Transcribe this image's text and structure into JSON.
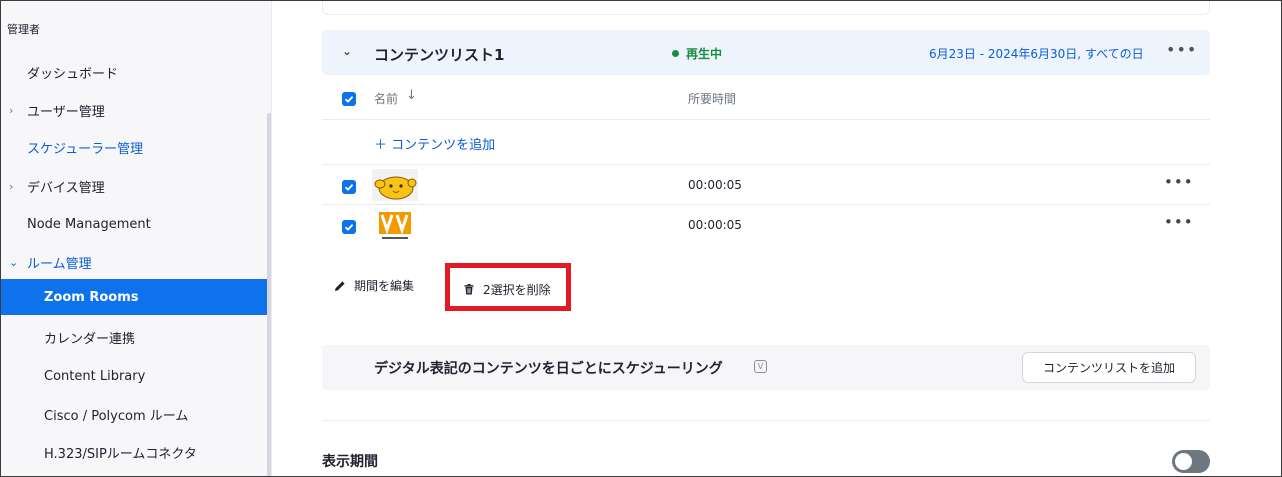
{
  "sidebar": {
    "header": "管理者",
    "items": [
      {
        "label": "ダッシュボード",
        "chevron": ""
      },
      {
        "label": "ユーザー管理",
        "chevron": "›"
      },
      {
        "label": "スケジューラー管理",
        "chevron": ""
      },
      {
        "label": "デバイス管理",
        "chevron": "›"
      },
      {
        "label": "Node Management",
        "chevron": ""
      },
      {
        "label": "ルーム管理",
        "chevron": "⌄"
      },
      {
        "label": "Zoom Rooms"
      },
      {
        "label": "カレンダー連携"
      },
      {
        "label": "Content Library"
      },
      {
        "label": "Cisco / Polycom ルーム"
      },
      {
        "label": "H.323/SIPルームコネクタ"
      }
    ]
  },
  "content_list": {
    "title": "コンテンツリスト1",
    "status": "再生中",
    "date_range": "6月23日 - 2024年6月30日, すべての日",
    "more": "•••",
    "columns": {
      "name": "名前",
      "sort_arrow": "↓",
      "duration": "所要時間"
    },
    "add_content": "＋  コンテンツを追加",
    "items": [
      {
        "thumbnail": "chick-sticker-icon",
        "duration": "00:00:05",
        "checked": true
      },
      {
        "thumbnail": "vv-logo-icon",
        "duration": "00:00:05",
        "checked": true
      }
    ]
  },
  "actions": {
    "edit_period": "期間を編集",
    "delete_selected": "2選択を削除"
  },
  "schedule": {
    "title": "デジタル表記のコンテンツを日ごとにスケジューリング",
    "info_icon": "V",
    "add_list_button": "コンテンツリストを追加"
  },
  "display_period": {
    "label": "表示期間",
    "enabled": false
  },
  "colors": {
    "accent": "#0e72ed",
    "link": "#0b5cd5",
    "status_green": "#1a8b3f",
    "highlight_red": "#e11a25"
  }
}
